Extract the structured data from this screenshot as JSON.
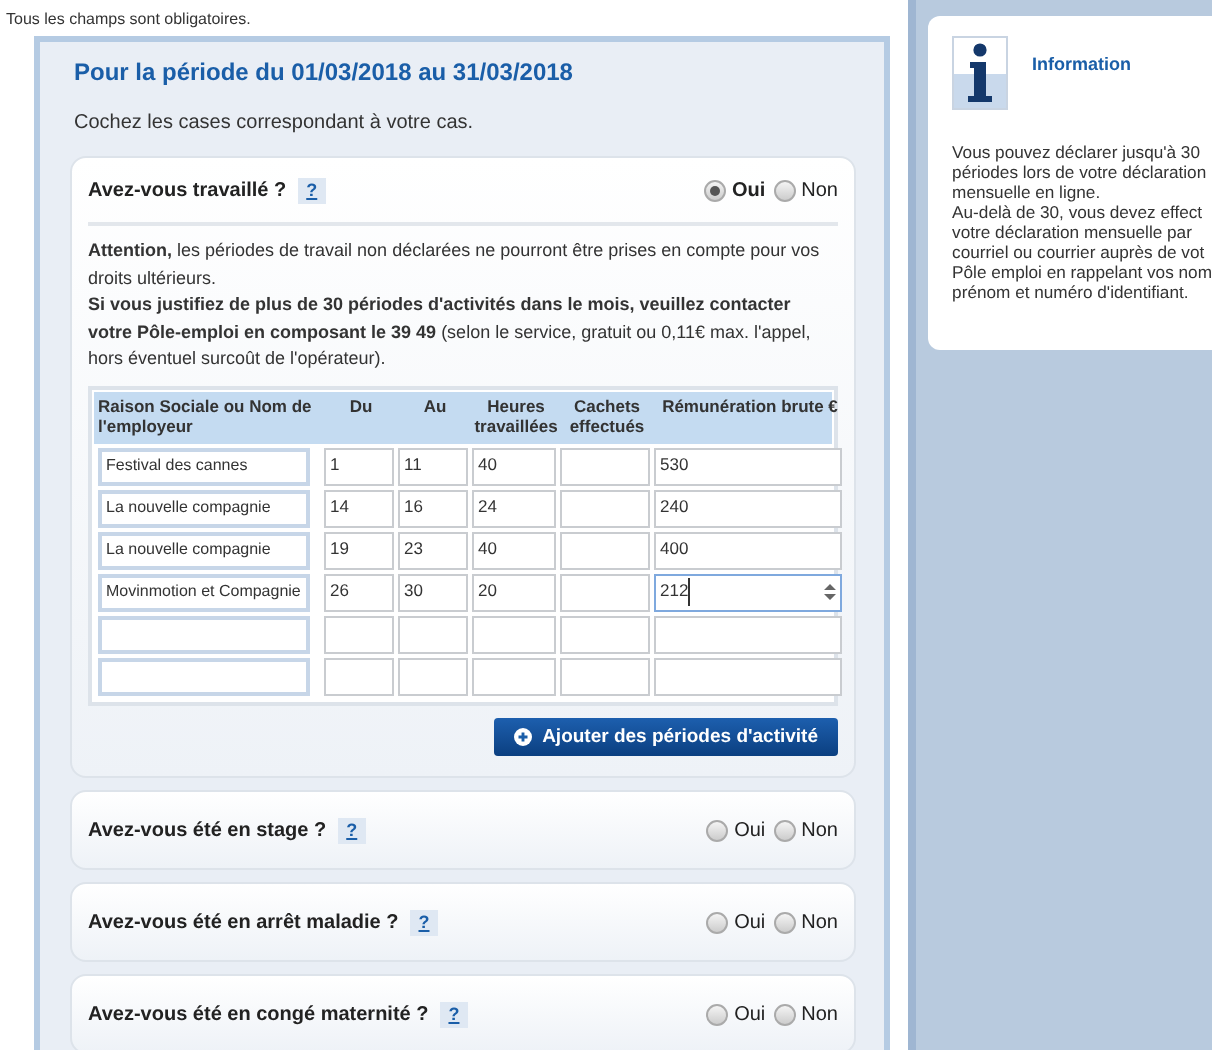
{
  "notice": "Tous les champs sont obligatoires.",
  "period_title": "Pour la période du 01/03/2018 au 31/03/2018",
  "instruction": "Cochez les cases correspondant à votre cas.",
  "questions": [
    {
      "label": "Avez-vous travaillé ?",
      "help": "?",
      "options": [
        {
          "label": "Oui",
          "selected": true
        },
        {
          "label": "Non",
          "selected": false
        }
      ],
      "details": {
        "warning": "**Attention,** les périodes de travail non déclarées ne pourront être prises en compte pour vos droits ultérieurs.",
        "contact": "**Si vous justifiez de plus de 30 périodes d'activités dans le mois, veuillez contacter votre Pôle-emploi en composant le 39 49** (selon le service, gratuit ou 0,11€ max. l'appel, hors éventuel surcoût de l'opérateur).",
        "table": {
          "columns": [
            "Raison Sociale ou Nom de l'employeur",
            "Du",
            "Au",
            "Heures travaillées",
            "Cachets effectués",
            "Rémunération brute €"
          ],
          "rows": [
            {
              "cells": [
                "Festival des cannes",
                "1",
                "11",
                "40",
                null,
                "530"
              ],
              "focused": false
            },
            {
              "cells": [
                "La nouvelle compagnie",
                "14",
                "16",
                "24",
                null,
                "240"
              ],
              "focused": false
            },
            {
              "cells": [
                "La nouvelle compagnie",
                "19",
                "23",
                "40",
                null,
                "400"
              ],
              "focused": false
            },
            {
              "cells": [
                "Movinmotion et Compagnie",
                "26",
                "30",
                "20",
                null,
                "212"
              ],
              "focused": true
            },
            {
              "cells": [
                null,
                null,
                null,
                null,
                null,
                null
              ],
              "focused": false
            },
            {
              "cells": [
                null,
                null,
                null,
                null,
                null,
                null
              ],
              "focused": false
            }
          ]
        },
        "add_button": "Ajouter des périodes d'activité"
      }
    },
    {
      "label": "Avez-vous été en stage ?",
      "help": "?",
      "options": [
        {
          "label": "Oui",
          "selected": false
        },
        {
          "label": "Non",
          "selected": false
        }
      ]
    },
    {
      "label": "Avez-vous été en arrêt maladie ?",
      "help": "?",
      "options": [
        {
          "label": "Oui",
          "selected": false
        },
        {
          "label": "Non",
          "selected": false
        }
      ]
    },
    {
      "label": "Avez-vous été en congé maternité ?",
      "help": "?",
      "options": [
        {
          "label": "Oui",
          "selected": false
        },
        {
          "label": "Non",
          "selected": false
        }
      ]
    }
  ],
  "info": {
    "title": "Information",
    "lines": [
      "Vous pouvez déclarer jusqu'à 30",
      "périodes lors de votre déclaration",
      "mensuelle en ligne.",
      "Au-delà de 30, vous devez effect",
      "votre déclaration mensuelle par",
      "courriel ou courrier auprès de vot",
      "Pôle emploi en rappelant vos nom",
      "prénom et numéro d'identifiant."
    ]
  }
}
